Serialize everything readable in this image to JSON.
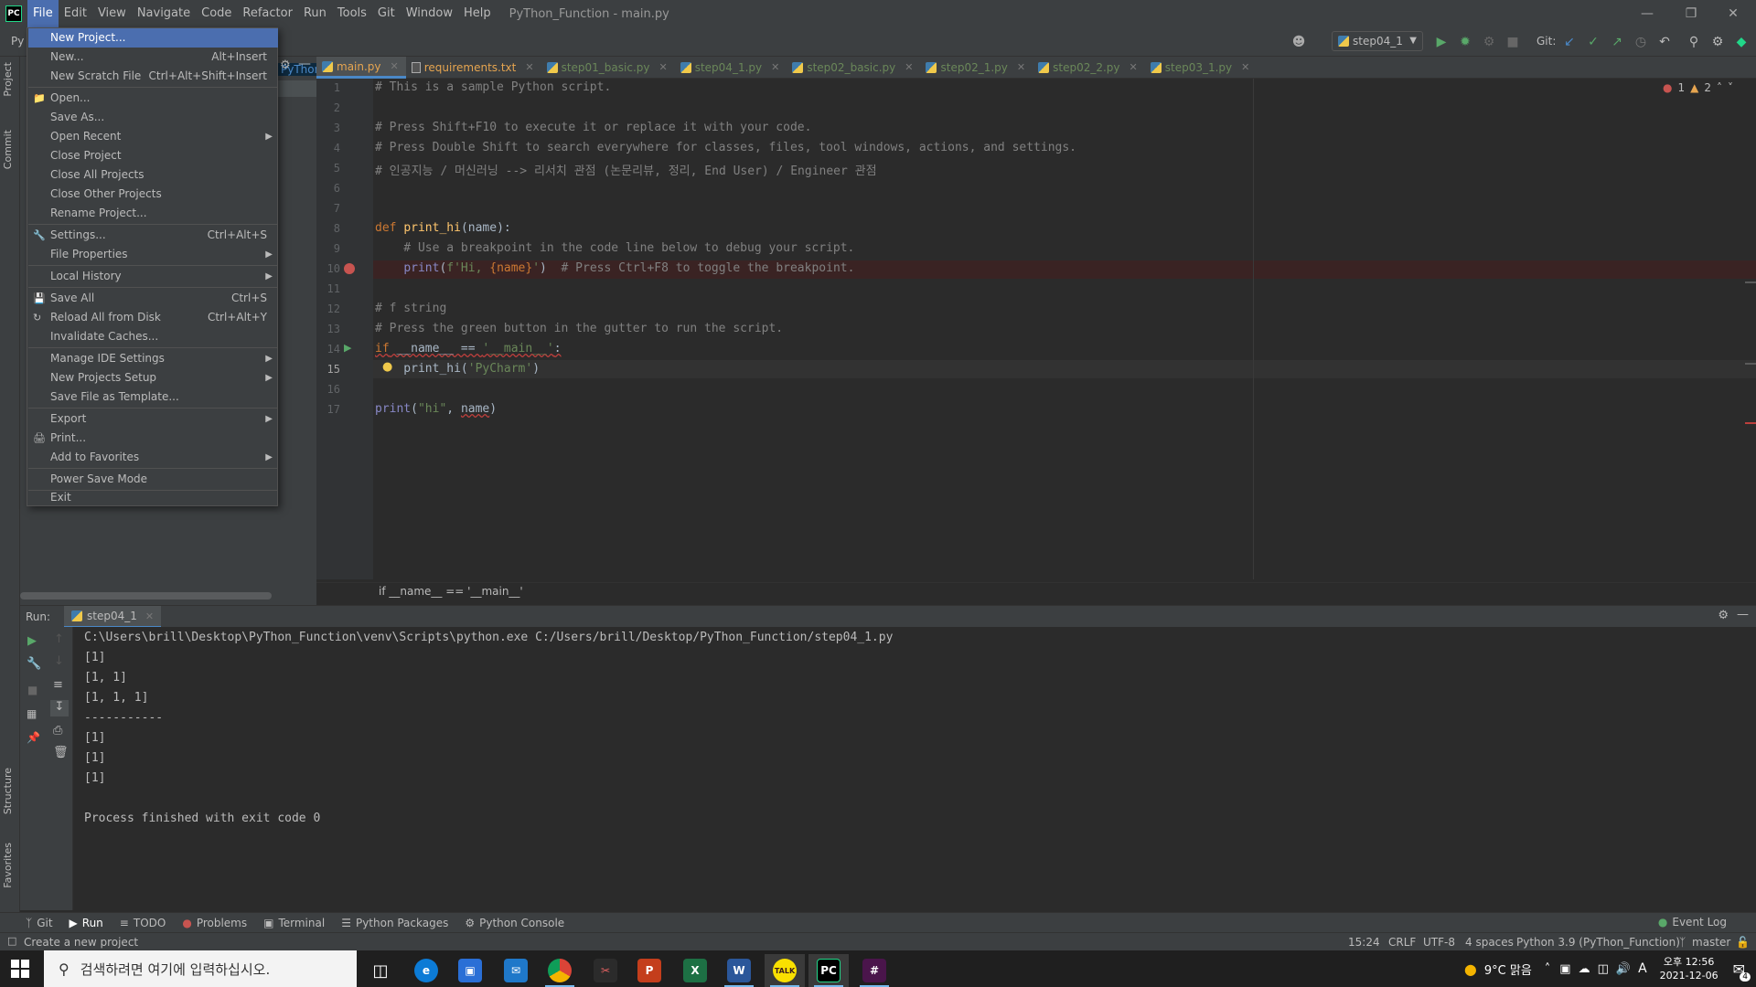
{
  "window": {
    "title": "PyThon_Function - main.py",
    "logo_text": "PC"
  },
  "menubar": [
    "File",
    "Edit",
    "View",
    "Navigate",
    "Code",
    "Refactor",
    "Run",
    "Tools",
    "Git",
    "Window",
    "Help"
  ],
  "toolbar": {
    "project_stub": "Py",
    "run_config": "step04_1",
    "git_label": "Git:"
  },
  "file_menu": {
    "items": [
      {
        "label": "New Project...",
        "shortcut": "",
        "submenu": false,
        "selected": true,
        "icon": ""
      },
      {
        "label": "New...",
        "shortcut": "Alt+Insert",
        "submenu": false,
        "icon": ""
      },
      {
        "label": "New Scratch File",
        "shortcut": "Ctrl+Alt+Shift+Insert",
        "submenu": false,
        "icon": ""
      },
      {
        "label": "Open...",
        "shortcut": "",
        "submenu": false,
        "icon": "folder-icon"
      },
      {
        "label": "Save As...",
        "shortcut": "",
        "submenu": false,
        "icon": ""
      },
      {
        "label": "Open Recent",
        "shortcut": "",
        "submenu": true,
        "icon": ""
      },
      {
        "label": "Close Project",
        "shortcut": "",
        "submenu": false,
        "icon": ""
      },
      {
        "label": "Close All Projects",
        "shortcut": "",
        "submenu": false,
        "icon": ""
      },
      {
        "label": "Close Other Projects",
        "shortcut": "",
        "submenu": false,
        "icon": ""
      },
      {
        "label": "Rename Project...",
        "shortcut": "",
        "submenu": false,
        "icon": ""
      },
      {
        "label": "Settings...",
        "shortcut": "Ctrl+Alt+S",
        "submenu": false,
        "icon": "wrench-icon"
      },
      {
        "label": "File Properties",
        "shortcut": "",
        "submenu": true,
        "icon": ""
      },
      {
        "label": "Local History",
        "shortcut": "",
        "submenu": true,
        "icon": ""
      },
      {
        "label": "Save All",
        "shortcut": "Ctrl+S",
        "submenu": false,
        "icon": "save-icon"
      },
      {
        "label": "Reload All from Disk",
        "shortcut": "Ctrl+Alt+Y",
        "submenu": false,
        "icon": "reload-icon"
      },
      {
        "label": "Invalidate Caches...",
        "shortcut": "",
        "submenu": false,
        "icon": ""
      },
      {
        "label": "Manage IDE Settings",
        "shortcut": "",
        "submenu": true,
        "icon": ""
      },
      {
        "label": "New Projects Setup",
        "shortcut": "",
        "submenu": true,
        "icon": ""
      },
      {
        "label": "Save File as Template...",
        "shortcut": "",
        "submenu": false,
        "icon": ""
      },
      {
        "label": "Export",
        "shortcut": "",
        "submenu": true,
        "icon": ""
      },
      {
        "label": "Print...",
        "shortcut": "",
        "submenu": false,
        "icon": "print-icon"
      },
      {
        "label": "Add to Favorites",
        "shortcut": "",
        "submenu": true,
        "icon": ""
      },
      {
        "label": "Power Save Mode",
        "shortcut": "",
        "submenu": false,
        "icon": ""
      },
      {
        "label": "Exit",
        "shortcut": "",
        "submenu": false,
        "icon": ""
      }
    ]
  },
  "project_panel": {
    "tree_stub": "PyThon"
  },
  "editor_tabs": [
    {
      "label": "main.py",
      "active": true,
      "kind": "py"
    },
    {
      "label": "requirements.txt",
      "active": false,
      "kind": "txt"
    },
    {
      "label": "step01_basic.py",
      "active": false,
      "kind": "py"
    },
    {
      "label": "step04_1.py",
      "active": false,
      "kind": "py"
    },
    {
      "label": "step02_basic.py",
      "active": false,
      "kind": "py"
    },
    {
      "label": "step02_1.py",
      "active": false,
      "kind": "py"
    },
    {
      "label": "step02_2.py",
      "active": false,
      "kind": "py"
    },
    {
      "label": "step03_1.py",
      "active": false,
      "kind": "py"
    }
  ],
  "editor": {
    "line_numbers": [
      "1",
      "2",
      "3",
      "4",
      "5",
      "6",
      "7",
      "8",
      "9",
      "10",
      "11",
      "12",
      "13",
      "14",
      "15",
      "16",
      "17"
    ],
    "errors": "1",
    "warnings": "2",
    "lines": {
      "l1": "# This is a sample Python script.",
      "l3": "# Press Shift+F10 to execute it or replace it with your code.",
      "l4": "# Press Double Shift to search everywhere for classes, files, tool windows, actions, and settings.",
      "l5": "# 인공지능 / 머신러닝 --> 리서치 관점 (논문리뷰, 정리, End User) / Engineer 관점",
      "l8_kw": "def",
      "l8_fn": "print_hi",
      "l8_rest": "(name):",
      "l9": "    # Use a breakpoint in the code line below to debug your script.",
      "l10_a": "    ",
      "l10_fn": "print",
      "l10_b": "(",
      "l10_str1": "f'Hi, ",
      "l10_brace": "{name}",
      "l10_str2": "'",
      "l10_c": ")  ",
      "l10_cm": "# Press Ctrl+F8 to toggle the breakpoint.",
      "l12": "# f string",
      "l13": "# Press the green button in the gutter to run the script.",
      "l14_kw": "if",
      "l14_a": " __name__ == ",
      "l14_str": "'__main__'",
      "l14_b": ":",
      "l15_a": "    print_hi(",
      "l15_str": "'PyCharm'",
      "l15_b": ")",
      "l17_fn": "print",
      "l17_a": "(",
      "l17_str": "\"hi\"",
      "l17_b": ", ",
      "l17_name": "name",
      "l17_c": ")"
    },
    "breadcrumb": "if __name__ == '__main__'"
  },
  "run_panel": {
    "label": "Run:",
    "tab": "step04_1",
    "output": [
      "C:\\Users\\brill\\Desktop\\PyThon_Function\\venv\\Scripts\\python.exe C:/Users/brill/Desktop/PyThon_Function/step04_1.py",
      "[1]",
      "[1, 1]",
      "[1, 1, 1]",
      "-----------",
      "[1]",
      "[1]",
      "[1]",
      "",
      "Process finished with exit code 0"
    ]
  },
  "bottom_tabs": [
    {
      "label": "Git",
      "icon": "git-branch-icon"
    },
    {
      "label": "Run",
      "icon": "play-icon"
    },
    {
      "label": "TODO",
      "icon": "list-icon"
    },
    {
      "label": "Problems",
      "icon": "problem-icon"
    },
    {
      "label": "Terminal",
      "icon": "terminal-icon"
    },
    {
      "label": "Python Packages",
      "icon": "packages-icon"
    },
    {
      "label": "Python Console",
      "icon": "python-console-icon"
    }
  ],
  "left_strip": {
    "project": "Project",
    "commit": "Commit",
    "structure": "Structure",
    "favorites": "Favorites"
  },
  "statusbar": {
    "message": "Create a new project",
    "position": "15:24",
    "line_sep": "CRLF",
    "encoding": "UTF-8",
    "indent": "4 spaces",
    "interpreter": "Python 3.9 (PyThon_Function)",
    "branch": "master",
    "event_log": "Event Log"
  },
  "taskbar": {
    "search_placeholder": "검색하려면 여기에 입력하십시오.",
    "weather": "9°C  맑음",
    "ime": "A",
    "time": "오후 12:56",
    "date": "2021-12-06",
    "notifications": "4"
  },
  "colors": {
    "accent": "#4b6eaf",
    "editor_bg": "#2b2b2b",
    "panel_bg": "#3c3f41"
  }
}
